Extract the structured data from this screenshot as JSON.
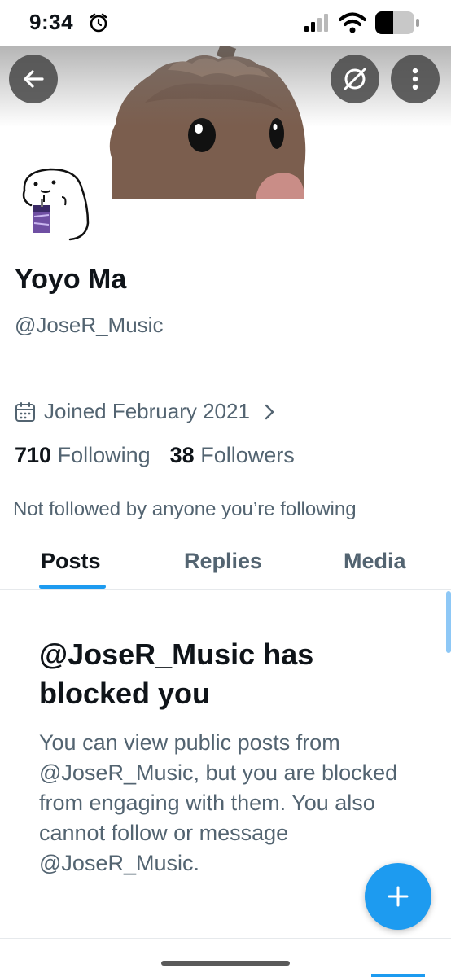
{
  "status_bar": {
    "time": "9:34"
  },
  "profile": {
    "display_name": "Yoyo Ma",
    "handle": "@JoseR_Music",
    "joined": "Joined February 2021",
    "following_count": "710",
    "following_label": "Following",
    "followers_count": "38",
    "followers_label": "Followers",
    "not_followed_text": "Not followed by anyone you’re following"
  },
  "tabs": [
    {
      "label": "Posts",
      "active": true
    },
    {
      "label": "Replies",
      "active": false
    },
    {
      "label": "Media",
      "active": false
    }
  ],
  "blocked_notice": {
    "title": "@JoseR_Music has blocked you",
    "body": "You can view public posts from @JoseR_Music, but you are blocked from engaging with them. You also cannot follow or message @JoseR_Music."
  },
  "icons": {
    "back": "arrow-left-icon",
    "vpn": "no-sync-icon",
    "more": "more-vertical-icon",
    "calendar": "calendar-icon",
    "chevron": "chevron-right-icon",
    "compose": "plus-icon"
  },
  "colors": {
    "accent": "#1d9bf0",
    "secondary_text": "#536471",
    "primary_text": "#0f1419"
  }
}
